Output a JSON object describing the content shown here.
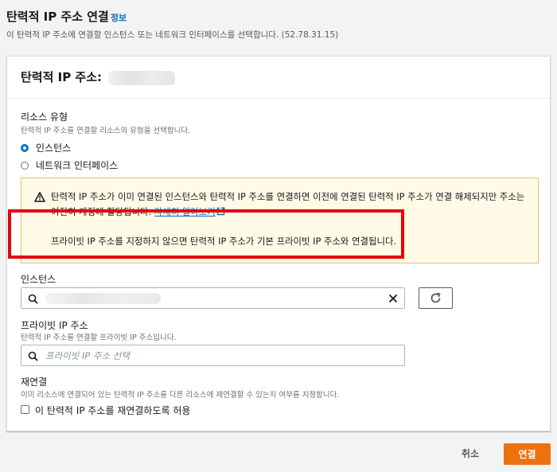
{
  "header": {
    "title": "탄력적 IP 주소 연결",
    "info_link": "정보",
    "description": "이 탄력적 IP 주소에 연결할 인스턴스 또는 네트워크 인터페이스를 선택합니다. (52.78.31.15)"
  },
  "panel": {
    "title": "탄력적 IP 주소:"
  },
  "resource_type": {
    "label": "리소스 유형",
    "description": "탄력적 IP 주소를 연결할 리소스의 유형을 선택합니다.",
    "options": [
      {
        "label": "인스턴스",
        "selected": true
      },
      {
        "label": "네트워크 인터페이스",
        "selected": false
      }
    ]
  },
  "alert": {
    "text": "탄력적 IP 주소가 이미 연결된 인스턴스와 탄력적 IP 주소를 연결하면 이전에 연결된 탄력적 IP 주소가 연결 해제되지만 주소는 여전히 계정에 할당됩니다.",
    "link": "자세히 알아보기",
    "text2": "프라이빗 IP 주소를 지정하지 않으면 탄력적 IP 주소가 기본 프라이빗 IP 주소와 연결됩니다."
  },
  "instance": {
    "label": "인스턴스"
  },
  "private_ip": {
    "label": "프라이빗 IP 주소",
    "description": "탄력적 IP 주소를 연결할 프라이빗 IP 주소입니다.",
    "placeholder": "프라이빗 IP 주소 선택"
  },
  "reassociate": {
    "label": "재연결",
    "description": "이미 리소스에 연결되어 있는 탄력적 IP 주소를 다른 리소스에 재연결할 수 있는지 여부를 지정합니다.",
    "checkbox_label": "이 탄력적 IP 주소를 재연결하도록 허용",
    "checked": false
  },
  "footer": {
    "cancel": "취소",
    "connect": "연결"
  },
  "colors": {
    "accent": "#0073bb",
    "primary_button": "#ec7211",
    "highlight": "#e7000b",
    "warning": "#fffbe6"
  }
}
